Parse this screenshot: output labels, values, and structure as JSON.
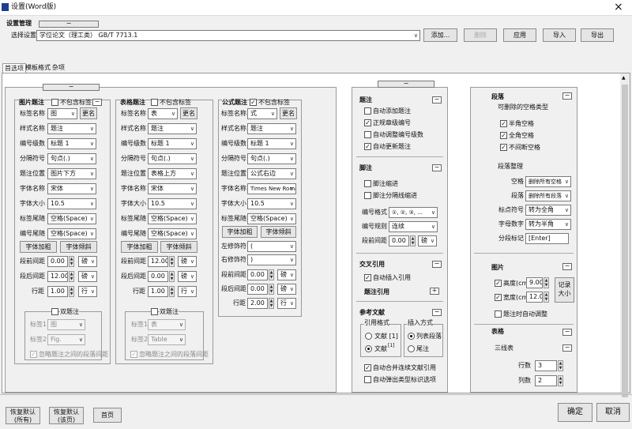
{
  "window": {
    "title": "设置(Word版)",
    "close": "×"
  },
  "header": {
    "section": "设置管理",
    "minimize": "−"
  },
  "settings_row": {
    "label": "选择设置",
    "value": "学位论文（理工类） GB/T 7713.1",
    "buttons": [
      "添加...",
      "删除",
      "应用",
      "导入",
      "导出"
    ]
  },
  "tabs": [
    "首选项",
    "模板格式",
    "杂项"
  ],
  "panel_minus": "−",
  "fig": {
    "title": "图片题注",
    "exclude": "不包含标签",
    "toggle": "−",
    "rows": [
      {
        "label": "标签名称",
        "value": "图",
        "btn": "更名"
      },
      {
        "label": "样式名称",
        "value": "题注"
      },
      {
        "label": "编号级数",
        "value": "标题 1"
      },
      {
        "label": "分隔符号",
        "value": "句点(.)"
      },
      {
        "label": "题注位置",
        "value": "图片下方"
      },
      {
        "label": "字体名称",
        "value": "宋体"
      },
      {
        "label": "字体大小",
        "value": "10.5"
      },
      {
        "label": "标签尾随",
        "value": "空格(Space)"
      },
      {
        "label": "编号尾随",
        "value": "空格(Space)"
      }
    ],
    "btn_bold": "字体加粗",
    "btn_italic": "字体倾斜",
    "spins": [
      {
        "label": "段前间距",
        "value": "0.00",
        "unit": "磅"
      },
      {
        "label": "段后间距",
        "value": "12.00",
        "unit": "磅"
      },
      {
        "label": "行距",
        "value": "1.00",
        "unit": "行"
      }
    ],
    "dual": {
      "title": "双题注",
      "l1": "标签1",
      "v1": "图",
      "l2": "标签2",
      "v2": "Fig.",
      "check": "忽略题注之间的段落间距"
    }
  },
  "tbl": {
    "title": "表格题注",
    "exclude": "不包含标签",
    "rows": [
      {
        "label": "标签名称",
        "value": "表",
        "btn": "更名"
      },
      {
        "label": "样式名称",
        "value": "题注"
      },
      {
        "label": "编号级数",
        "value": "标题 1"
      },
      {
        "label": "分隔符号",
        "value": "句点(.)"
      },
      {
        "label": "题注位置",
        "value": "表格上方"
      },
      {
        "label": "字体名称",
        "value": "宋体"
      },
      {
        "label": "字体大小",
        "value": "10.5"
      },
      {
        "label": "标签尾随",
        "value": "空格(Space)"
      },
      {
        "label": "编号尾随",
        "value": "空格(Space)"
      }
    ],
    "btn_bold": "字体加粗",
    "btn_italic": "字体倾斜",
    "spins": [
      {
        "label": "段前间距",
        "value": "12.00",
        "unit": "磅"
      },
      {
        "label": "段后间距",
        "value": "0.00",
        "unit": "磅"
      },
      {
        "label": "行距",
        "value": "1.00",
        "unit": "行"
      }
    ],
    "dual": {
      "title": "双题注",
      "l1": "标签1",
      "v1": "表",
      "l2": "标签2",
      "v2": "Table",
      "check": "忽略题注之间的段落间距"
    }
  },
  "eq": {
    "title": "公式题注",
    "exclude": "不包含标签",
    "rows": [
      {
        "label": "标签名称",
        "value": "式",
        "btn": "更名"
      },
      {
        "label": "样式名称",
        "value": "题注"
      },
      {
        "label": "编号级数",
        "value": "标题 1"
      },
      {
        "label": "分隔符号",
        "value": "句点(.)"
      },
      {
        "label": "题注位置",
        "value": "公式右边"
      },
      {
        "label": "字体名称",
        "value": "Times New Roman"
      },
      {
        "label": "字体大小",
        "value": "10.5"
      },
      {
        "label": "标签尾随",
        "value": "空格(Space)"
      }
    ],
    "btn_bold": "字体加粗",
    "btn_italic": "字体倾斜",
    "inputs": [
      {
        "label": "左修饰符",
        "value": "("
      },
      {
        "label": "右修饰符",
        "value": ")"
      }
    ],
    "spins": [
      {
        "label": "段前间距",
        "value": "0.00",
        "unit": "磅"
      },
      {
        "label": "段后间距",
        "value": "0.00",
        "unit": "磅"
      },
      {
        "label": "行距",
        "value": "2.00",
        "unit": "行"
      }
    ]
  },
  "mid": {
    "caption": {
      "title": "题注",
      "items": [
        "自动添加题注",
        "正规章级编号",
        "自动调整编号级数",
        "自动更新题注"
      ],
      "checked": [
        false,
        true,
        false,
        true
      ]
    },
    "foot": {
      "title": "脚注",
      "items": [
        "脚注缩进",
        "脚注分隔线缩进"
      ],
      "f1": "编号格式",
      "v1": "①, ②, ③, ...",
      "f2": "编号规则",
      "v2": "连续",
      "f3": "段前间距",
      "v3": "0.00",
      "u3": "磅"
    },
    "xref": {
      "title": "交叉引用",
      "auto": "自动插入引用",
      "sub": "题注引用",
      "plus": "+"
    },
    "ref": {
      "title": "参考文献",
      "g1": "引用格式",
      "r1": "文献 [1]",
      "r2": "文献",
      "sup": "[1]",
      "g2": "插入方式",
      "r3": "列表段落",
      "r4": "尾注",
      "c1": "自动合并连续文献引用",
      "c2": "自动弹出类型标识选项"
    }
  },
  "right": {
    "para": {
      "title": "段落",
      "sub": "可删除的空格类型",
      "items": [
        "半角空格",
        "全角空格",
        "不间断空格"
      ],
      "tidy": "段落整理",
      "rows": [
        {
          "label": "空格",
          "value": "删除所有空格"
        },
        {
          "label": "段落",
          "value": "删除所有段落"
        },
        {
          "label": "标点符号",
          "value": "转为全角"
        },
        {
          "label": "字母数字",
          "value": "转为半角"
        },
        {
          "label": "分段标记",
          "value": "[Enter]"
        }
      ]
    },
    "pic": {
      "title": "图片",
      "h": "高度(cm)",
      "hv": "9.00",
      "w": "宽度(cm)",
      "wv": "12.00",
      "rec": "记录大小",
      "auto": "题注时自动调整"
    },
    "table": {
      "title": "表格",
      "sub": "三线表",
      "rows": "行数",
      "rv": "3",
      "cols": "列数",
      "cv": "2"
    }
  },
  "footer": {
    "b1": "恢复默认(所有)",
    "b2": "恢复默认(该页)",
    "b3": "首页",
    "ok": "确定",
    "cancel": "取消"
  }
}
